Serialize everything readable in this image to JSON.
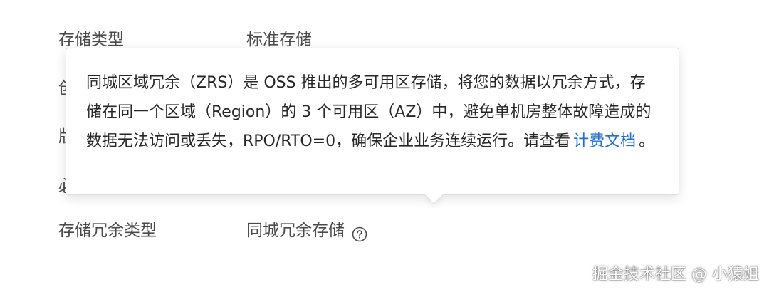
{
  "rows": {
    "storage_type": {
      "label": "存储类型",
      "value": "标准存储"
    },
    "redundancy_type": {
      "label": "存储冗余类型",
      "value": "同城冗余存储"
    }
  },
  "peeks": [
    "创",
    "版",
    "必"
  ],
  "popover": {
    "text_before": "同城区域冗余（ZRS）是 OSS 推出的多可用区存储，将您的数据以冗余方式，存储在同一个区域（Region）的 3 个可用区（AZ）中，避免单机房整体故障造成的数据无法访问或丢失，RPO/RTO=0，确保企业业务连续运行。请查看",
    "link_label": "计费文档",
    "text_after": "。"
  },
  "icons": {
    "help": "question-circle-icon"
  },
  "watermark": "掘金技术社区 @ 小猿姐"
}
